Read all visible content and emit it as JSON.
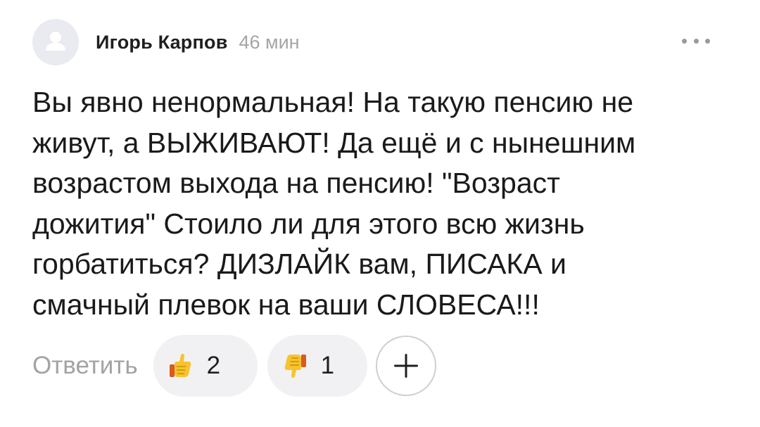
{
  "comment": {
    "author": "Игорь Карпов",
    "time": "46 мин",
    "text": "Вы явно ненормальная! На такую пенсию не\nживут, а ВЫЖИВАЮТ! Да ещё и с нынешним\nвозрастом выхода на пенсию! \"Возраст\nдожития\" Стоило ли для этого всю жизнь\nгорбатиться? ДИЗЛАЙК вам, ПИСАКА и\nсмачный плевок на ваши СЛОВЕСА!!!",
    "more_icon": "ellipsis-icon",
    "avatar_icon": "user-placeholder-icon"
  },
  "actions": {
    "reply_label": "Ответить",
    "like_icon": "thumbs-up-emoji",
    "like_count": "2",
    "dislike_icon": "thumbs-down-emoji",
    "dislike_count": "1",
    "add_reaction_icon": "plus-icon"
  },
  "colors": {
    "avatar_bg": "#e9ebf1",
    "time_text": "#a5a5a5",
    "reply_text": "#a3a3a3",
    "pill_bg": "#f1f1f3"
  }
}
